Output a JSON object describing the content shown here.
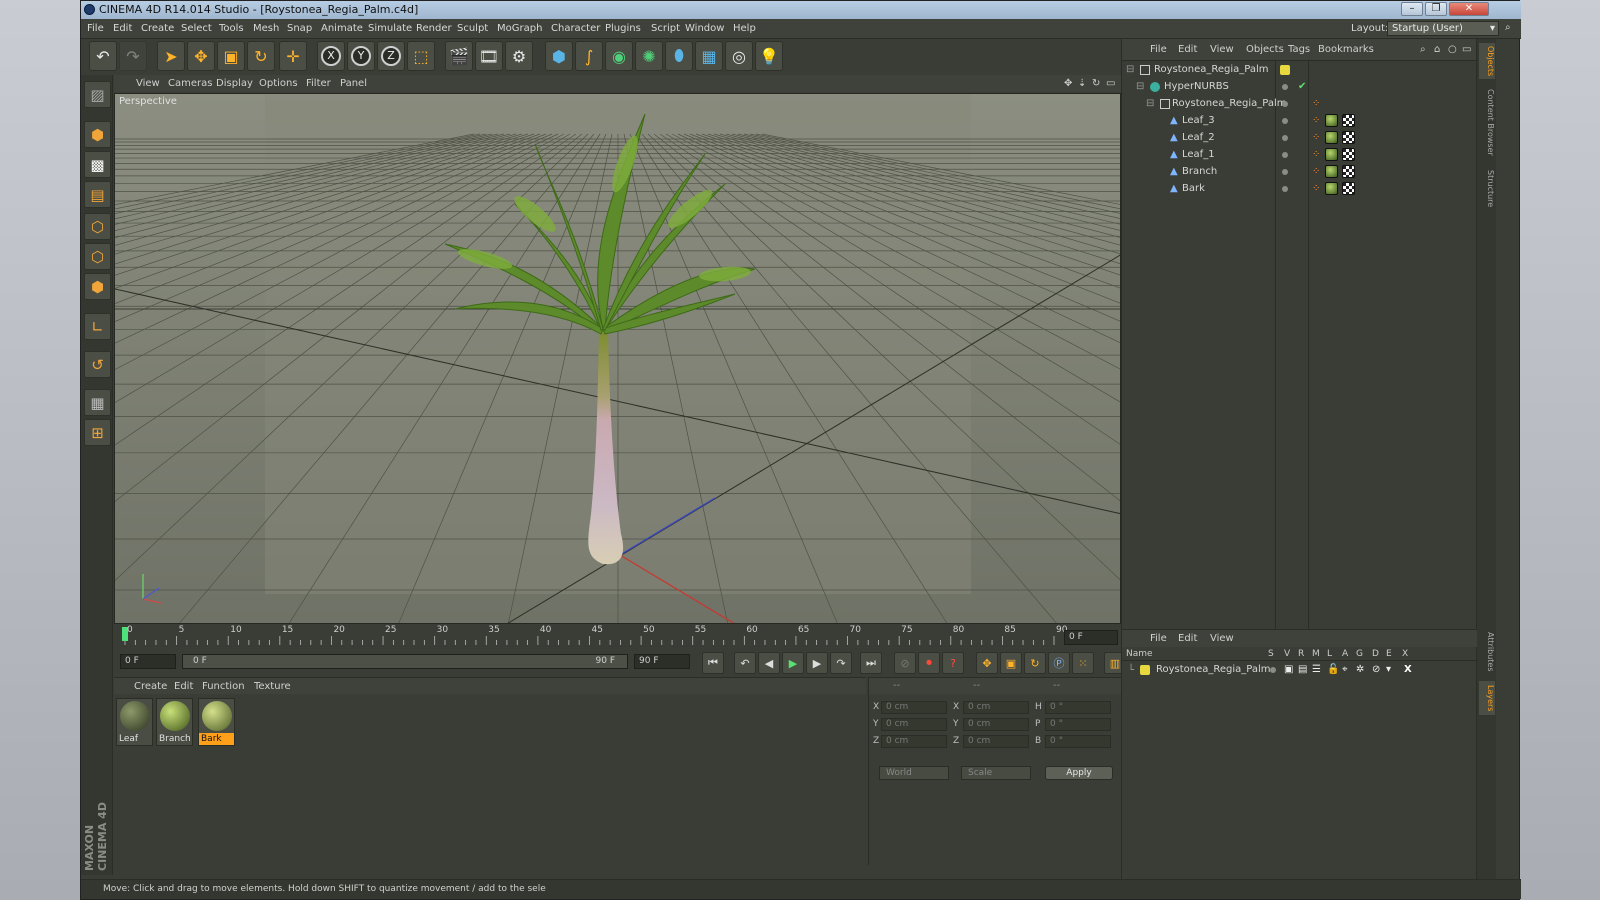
{
  "window": {
    "title": "CINEMA 4D R14.014 Studio - [Roystonea_Regia_Palm.c4d]",
    "controls": [
      "–",
      "❐",
      "✕"
    ]
  },
  "menubar": {
    "items": [
      "File",
      "Edit",
      "Create",
      "Select",
      "Tools",
      "Mesh",
      "Snap",
      "Animate",
      "Simulate",
      "Render",
      "Sculpt",
      "MoGraph",
      "Character",
      "Plugins",
      "Script",
      "Window",
      "Help"
    ],
    "layout_label": "Layout:",
    "layout_value": "Startup (User)"
  },
  "toolbar": {
    "axis_labels": [
      "X",
      "Y",
      "Z"
    ]
  },
  "viewport": {
    "menu": [
      "View",
      "Cameras",
      "Display",
      "Options",
      "Filter",
      "Panel"
    ],
    "label": "Perspective",
    "colors": {
      "background": "#787b6e",
      "grid": "#4a4d42"
    }
  },
  "timeline": {
    "ticks": [
      "0",
      "5",
      "10",
      "15",
      "20",
      "25",
      "30",
      "35",
      "40",
      "45",
      "50",
      "55",
      "60",
      "65",
      "70",
      "75",
      "80",
      "85",
      "90"
    ],
    "current_frame": "0 F",
    "start_field": "0 F",
    "range_start": "0 F",
    "range_end": "90 F",
    "end_field": "90 F"
  },
  "materials": {
    "menu": [
      "Create",
      "Edit",
      "Function",
      "Texture"
    ],
    "items": [
      {
        "name": "Leaf",
        "color": "#4b5a33"
      },
      {
        "name": "Branch",
        "color": "#7d9a32"
      },
      {
        "name": "Bark",
        "color": "#8ea352"
      }
    ],
    "selected": "Bark"
  },
  "coordinates": {
    "header": [
      "--",
      "--",
      "--"
    ],
    "rows": [
      {
        "l1": "X",
        "v1": "0 cm",
        "l2": "X",
        "v2": "0 cm",
        "l3": "H",
        "v3": "0 °"
      },
      {
        "l1": "Y",
        "v1": "0 cm",
        "l2": "Y",
        "v2": "0 cm",
        "l3": "P",
        "v3": "0 °"
      },
      {
        "l1": "Z",
        "v1": "0 cm",
        "l2": "Z",
        "v2": "0 cm",
        "l3": "B",
        "v3": "0 °"
      }
    ],
    "mode": "World",
    "type": "Scale",
    "apply": "Apply"
  },
  "objects": {
    "menu": [
      "File",
      "Edit",
      "View",
      "Objects",
      "Tags",
      "Bookmarks"
    ],
    "tree": [
      {
        "name": "Roystonea_Regia_Palm",
        "depth": 0,
        "icon": "null-icon"
      },
      {
        "name": "HyperNURBS",
        "depth": 1,
        "icon": "hypernurbs-icon"
      },
      {
        "name": "Roystonea_Regia_Palm",
        "depth": 2,
        "icon": "null-icon"
      },
      {
        "name": "Leaf_3",
        "depth": 3,
        "icon": "polygon-icon"
      },
      {
        "name": "Leaf_2",
        "depth": 3,
        "icon": "polygon-icon"
      },
      {
        "name": "Leaf_1",
        "depth": 3,
        "icon": "polygon-icon"
      },
      {
        "name": "Branch",
        "depth": 3,
        "icon": "polygon-icon"
      },
      {
        "name": "Bark",
        "depth": 3,
        "icon": "polygon-icon"
      }
    ]
  },
  "side_tabs": [
    "Objects",
    "Content Browser",
    "Structure",
    "Attributes",
    "Layers"
  ],
  "layers": {
    "menu": [
      "File",
      "Edit",
      "View"
    ],
    "columns": [
      "Name",
      "S",
      "V",
      "R",
      "M",
      "L",
      "A",
      "G",
      "D",
      "E",
      "X"
    ],
    "rows": [
      {
        "name": "Roystonea_Regia_Palm",
        "color": "#e8d840"
      }
    ]
  },
  "status": "Move: Click and drag to move elements. Hold down SHIFT to quantize movement / add to the sele",
  "brand": "MAXON CINEMA 4D"
}
